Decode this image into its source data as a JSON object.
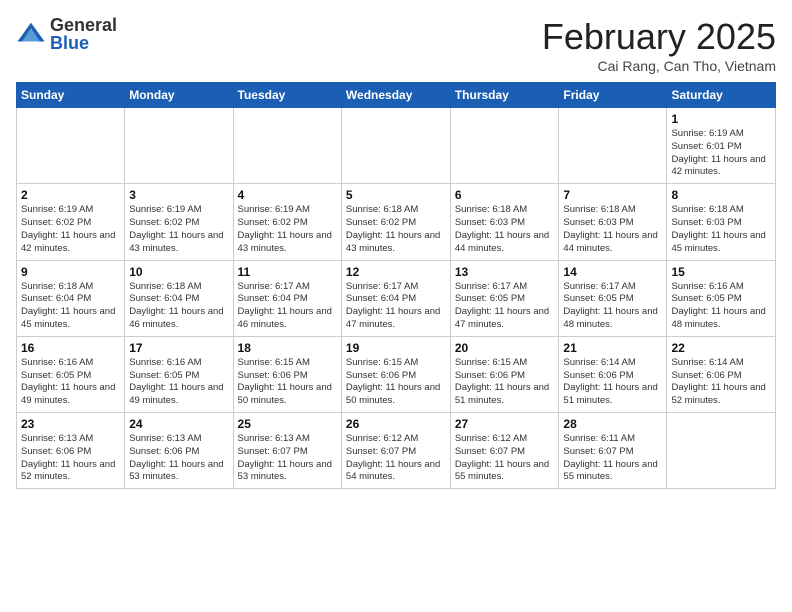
{
  "header": {
    "logo_general": "General",
    "logo_blue": "Blue",
    "month_title": "February 2025",
    "location": "Cai Rang, Can Tho, Vietnam"
  },
  "weekdays": [
    "Sunday",
    "Monday",
    "Tuesday",
    "Wednesday",
    "Thursday",
    "Friday",
    "Saturday"
  ],
  "weeks": [
    [
      {
        "day": "",
        "info": ""
      },
      {
        "day": "",
        "info": ""
      },
      {
        "day": "",
        "info": ""
      },
      {
        "day": "",
        "info": ""
      },
      {
        "day": "",
        "info": ""
      },
      {
        "day": "",
        "info": ""
      },
      {
        "day": "1",
        "info": "Sunrise: 6:19 AM\nSunset: 6:01 PM\nDaylight: 11 hours and 42 minutes."
      }
    ],
    [
      {
        "day": "2",
        "info": "Sunrise: 6:19 AM\nSunset: 6:02 PM\nDaylight: 11 hours and 42 minutes."
      },
      {
        "day": "3",
        "info": "Sunrise: 6:19 AM\nSunset: 6:02 PM\nDaylight: 11 hours and 43 minutes."
      },
      {
        "day": "4",
        "info": "Sunrise: 6:19 AM\nSunset: 6:02 PM\nDaylight: 11 hours and 43 minutes."
      },
      {
        "day": "5",
        "info": "Sunrise: 6:18 AM\nSunset: 6:02 PM\nDaylight: 11 hours and 43 minutes."
      },
      {
        "day": "6",
        "info": "Sunrise: 6:18 AM\nSunset: 6:03 PM\nDaylight: 11 hours and 44 minutes."
      },
      {
        "day": "7",
        "info": "Sunrise: 6:18 AM\nSunset: 6:03 PM\nDaylight: 11 hours and 44 minutes."
      },
      {
        "day": "8",
        "info": "Sunrise: 6:18 AM\nSunset: 6:03 PM\nDaylight: 11 hours and 45 minutes."
      }
    ],
    [
      {
        "day": "9",
        "info": "Sunrise: 6:18 AM\nSunset: 6:04 PM\nDaylight: 11 hours and 45 minutes."
      },
      {
        "day": "10",
        "info": "Sunrise: 6:18 AM\nSunset: 6:04 PM\nDaylight: 11 hours and 46 minutes."
      },
      {
        "day": "11",
        "info": "Sunrise: 6:17 AM\nSunset: 6:04 PM\nDaylight: 11 hours and 46 minutes."
      },
      {
        "day": "12",
        "info": "Sunrise: 6:17 AM\nSunset: 6:04 PM\nDaylight: 11 hours and 47 minutes."
      },
      {
        "day": "13",
        "info": "Sunrise: 6:17 AM\nSunset: 6:05 PM\nDaylight: 11 hours and 47 minutes."
      },
      {
        "day": "14",
        "info": "Sunrise: 6:17 AM\nSunset: 6:05 PM\nDaylight: 11 hours and 48 minutes."
      },
      {
        "day": "15",
        "info": "Sunrise: 6:16 AM\nSunset: 6:05 PM\nDaylight: 11 hours and 48 minutes."
      }
    ],
    [
      {
        "day": "16",
        "info": "Sunrise: 6:16 AM\nSunset: 6:05 PM\nDaylight: 11 hours and 49 minutes."
      },
      {
        "day": "17",
        "info": "Sunrise: 6:16 AM\nSunset: 6:05 PM\nDaylight: 11 hours and 49 minutes."
      },
      {
        "day": "18",
        "info": "Sunrise: 6:15 AM\nSunset: 6:06 PM\nDaylight: 11 hours and 50 minutes."
      },
      {
        "day": "19",
        "info": "Sunrise: 6:15 AM\nSunset: 6:06 PM\nDaylight: 11 hours and 50 minutes."
      },
      {
        "day": "20",
        "info": "Sunrise: 6:15 AM\nSunset: 6:06 PM\nDaylight: 11 hours and 51 minutes."
      },
      {
        "day": "21",
        "info": "Sunrise: 6:14 AM\nSunset: 6:06 PM\nDaylight: 11 hours and 51 minutes."
      },
      {
        "day": "22",
        "info": "Sunrise: 6:14 AM\nSunset: 6:06 PM\nDaylight: 11 hours and 52 minutes."
      }
    ],
    [
      {
        "day": "23",
        "info": "Sunrise: 6:13 AM\nSunset: 6:06 PM\nDaylight: 11 hours and 52 minutes."
      },
      {
        "day": "24",
        "info": "Sunrise: 6:13 AM\nSunset: 6:06 PM\nDaylight: 11 hours and 53 minutes."
      },
      {
        "day": "25",
        "info": "Sunrise: 6:13 AM\nSunset: 6:07 PM\nDaylight: 11 hours and 53 minutes."
      },
      {
        "day": "26",
        "info": "Sunrise: 6:12 AM\nSunset: 6:07 PM\nDaylight: 11 hours and 54 minutes."
      },
      {
        "day": "27",
        "info": "Sunrise: 6:12 AM\nSunset: 6:07 PM\nDaylight: 11 hours and 55 minutes."
      },
      {
        "day": "28",
        "info": "Sunrise: 6:11 AM\nSunset: 6:07 PM\nDaylight: 11 hours and 55 minutes."
      },
      {
        "day": "",
        "info": ""
      }
    ]
  ]
}
